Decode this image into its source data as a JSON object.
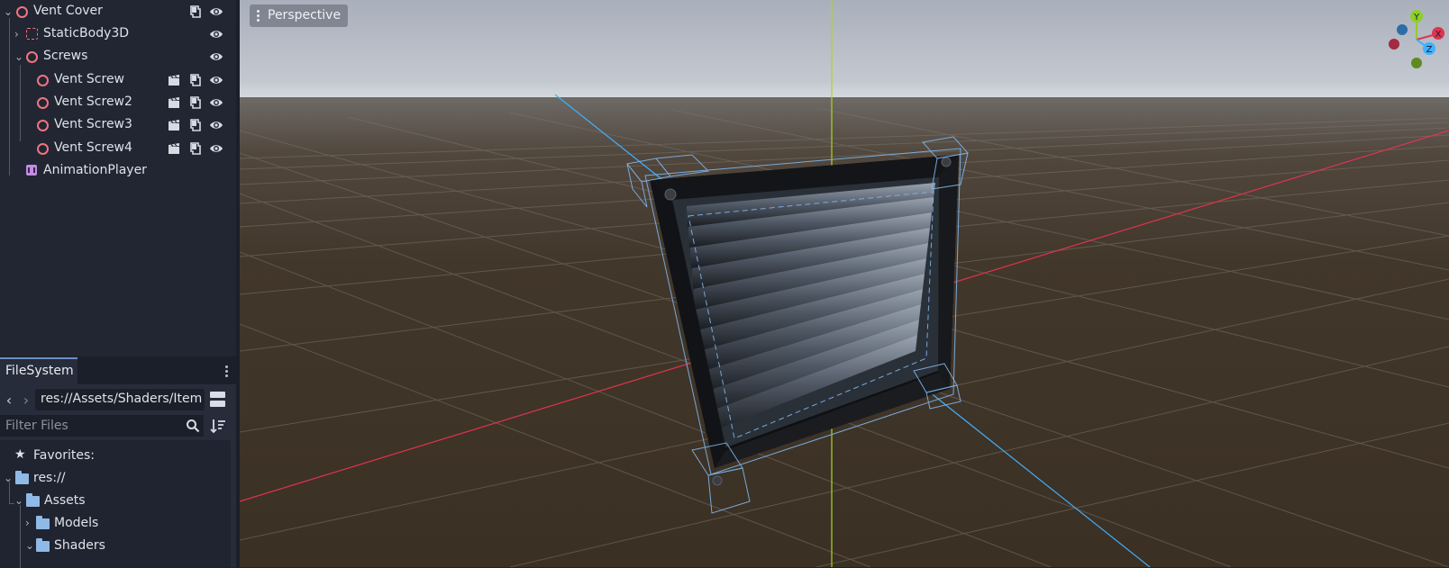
{
  "scene_tree": {
    "nodes": [
      {
        "label": "Vent Cover",
        "type": "Node3D"
      },
      {
        "label": "StaticBody3D",
        "type": "StaticBody3D"
      },
      {
        "label": "Screws",
        "type": "Node3D"
      },
      {
        "label": "Vent Screw",
        "type": "Node3D"
      },
      {
        "label": "Vent Screw2",
        "type": "Node3D"
      },
      {
        "label": "Vent Screw3",
        "type": "Node3D"
      },
      {
        "label": "Vent Screw4",
        "type": "Node3D"
      },
      {
        "label": "AnimationPlayer",
        "type": "AnimationPlayer"
      }
    ]
  },
  "filesystem": {
    "tab_label": "FileSystem",
    "path": "res://Assets/Shaders/ItemO",
    "filter_placeholder": "Filter Files",
    "favorites_label": "Favorites:",
    "items": [
      {
        "label": "res://"
      },
      {
        "label": "Assets"
      },
      {
        "label": "Models"
      },
      {
        "label": "Shaders"
      }
    ]
  },
  "viewport": {
    "view_menu_label": "Perspective",
    "gizmo": {
      "y": "Y",
      "x": "X",
      "z": "Z"
    }
  },
  "colors": {
    "accent": "#3d6fb3",
    "node_icon": "#f07480",
    "animation_icon": "#c28be8",
    "folder": "#8fb9e6",
    "x_axis": "#e0334f",
    "y_axis": "#8ccf2a",
    "z_axis": "#3fb1ff"
  }
}
